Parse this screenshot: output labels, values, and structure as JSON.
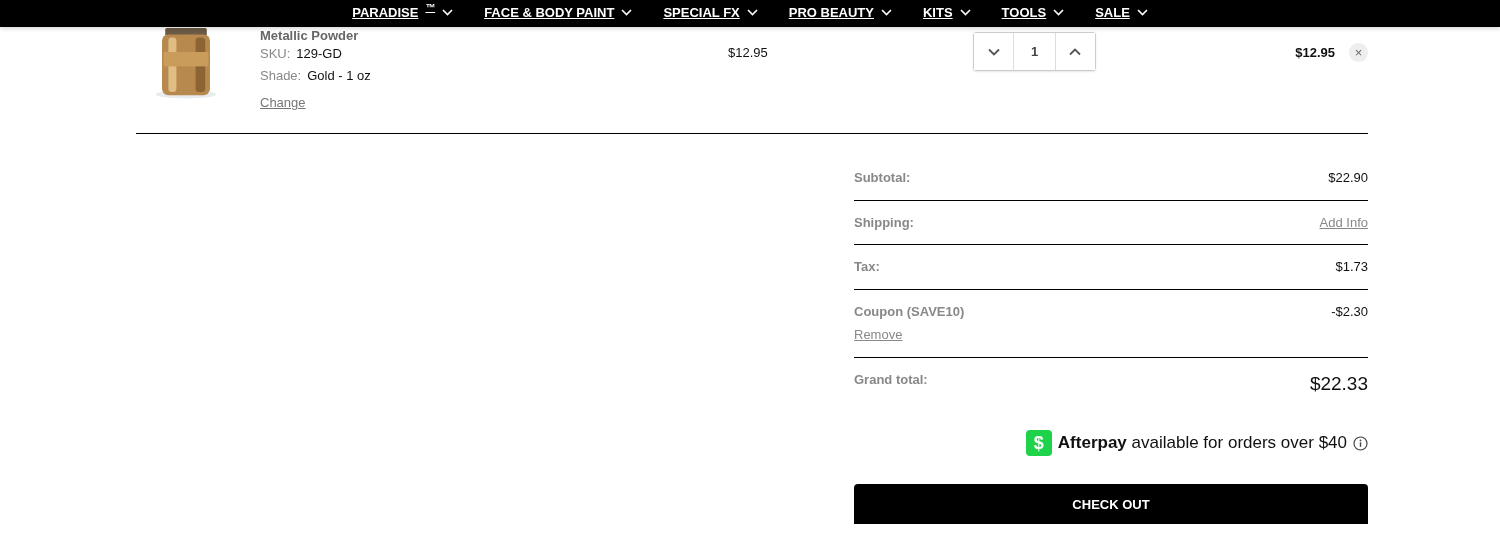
{
  "nav": [
    {
      "label": "PARADISE$^{™}$"
    },
    {
      "label": "FACE & BODY PAINT"
    },
    {
      "label": "SPECIAL FX"
    },
    {
      "label": "PRO BEAUTY"
    },
    {
      "label": "KITS"
    },
    {
      "label": "TOOLS"
    },
    {
      "label": "SALE"
    }
  ],
  "cart_item": {
    "name": "Metallic Powder",
    "details": [
      {
        "label": "SKU:",
        "value": "129-GD"
      },
      {
        "label": "Shade:",
        "value": "Gold - 1 oz"
      }
    ],
    "change": "Change",
    "price": "$12.95",
    "quantity": "1",
    "total": "$12.95",
    "remove": "×"
  },
  "summary": [
    {
      "label": "Subtotal:",
      "value": "$22.90",
      "kind": "text"
    },
    {
      "label": "Shipping:",
      "value": "Add Info",
      "kind": "link"
    },
    {
      "label": "Tax:",
      "value": "$1.73",
      "kind": "text"
    },
    {
      "label": "Coupon (SAVE10)",
      "value": "-$2.30",
      "kind": "coupon",
      "action": "Remove"
    },
    {
      "label": "Grand total:",
      "value": "$22.33",
      "kind": "total"
    }
  ],
  "afterpay": {
    "icon": "$",
    "brand": "Afterpay",
    "text": "available for orders over $40"
  },
  "checkout": "CHECK OUT"
}
